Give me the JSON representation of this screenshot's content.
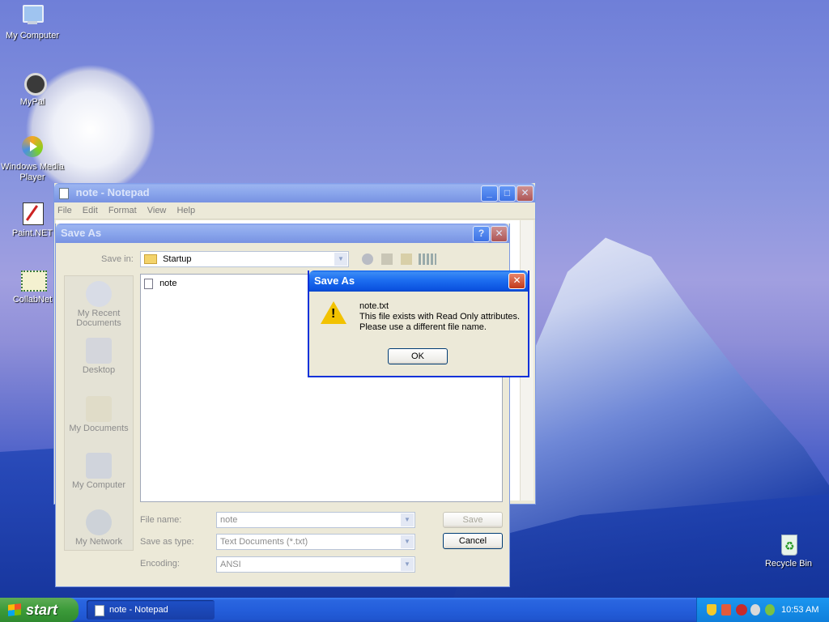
{
  "desktop": {
    "icons": [
      {
        "label": "My Computer"
      },
      {
        "label": "MyPal"
      },
      {
        "label": "Windows Media Player"
      },
      {
        "label": "Paint.NET"
      },
      {
        "label": "CollabNet"
      },
      {
        "label": "Recycle Bin"
      }
    ]
  },
  "notepad": {
    "title": "note - Notepad",
    "menu": [
      "File",
      "Edit",
      "Format",
      "View",
      "Help"
    ]
  },
  "save_as": {
    "title": "Save As",
    "save_in_label": "Save in:",
    "save_in_value": "Startup",
    "places": [
      "My Recent Documents",
      "Desktop",
      "My Documents",
      "My Computer",
      "My Network"
    ],
    "files": [
      "note"
    ],
    "file_name_label": "File name:",
    "file_name_value": "note",
    "save_type_label": "Save as type:",
    "save_type_value": "Text Documents (*.txt)",
    "encoding_label": "Encoding:",
    "encoding_value": "ANSI",
    "save_button": "Save",
    "cancel_button": "Cancel",
    "help_button": "?",
    "close_button": "✕"
  },
  "alert": {
    "title": "Save As",
    "line1": "note.txt",
    "line2": "This file exists with Read Only attributes.",
    "line3": "Please use a different file name.",
    "ok_button": "OK",
    "close_button": "✕"
  },
  "taskbar": {
    "start_label": "start",
    "task_label": "note - Notepad",
    "clock": "10:53 AM"
  }
}
